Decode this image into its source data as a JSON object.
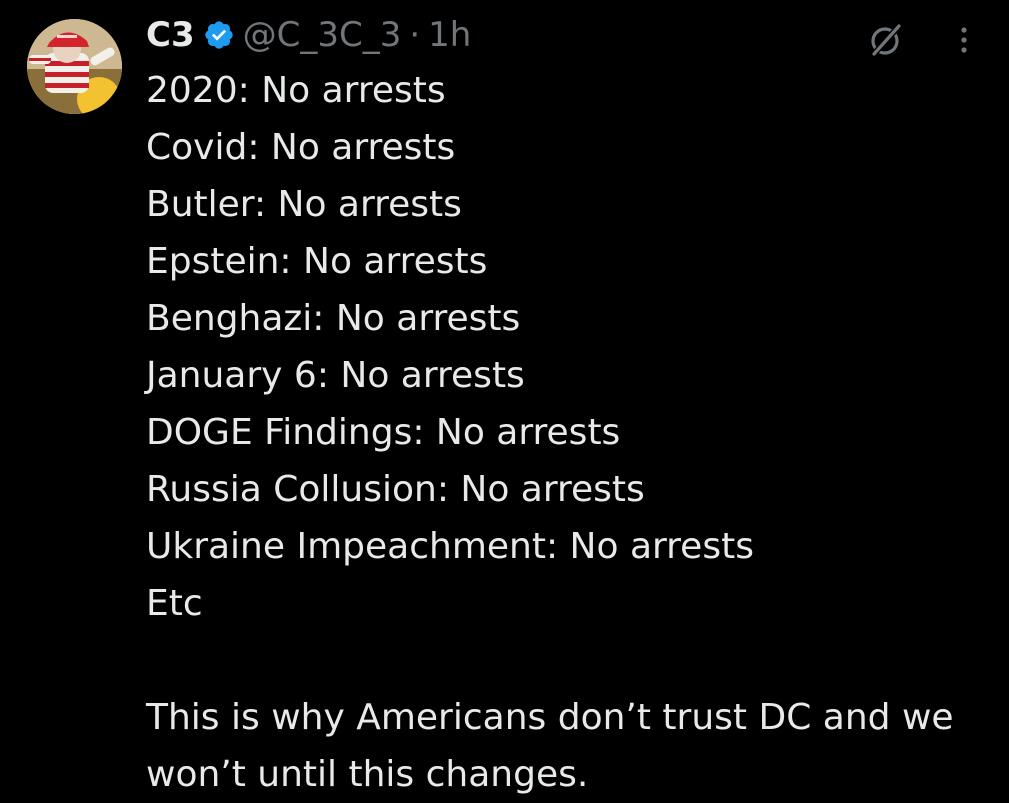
{
  "author": {
    "display_name": "C3",
    "handle": "@C_3C_3",
    "separator": "·",
    "time": "1h",
    "verified": true
  },
  "colors": {
    "background": "#000000",
    "text": "#e7e9ea",
    "secondary": "#71767b",
    "verified_badge": "#1d9bf0"
  },
  "icons": {
    "verified": "verified-badge-icon",
    "grok": "grok-icon",
    "more": "more-dots-icon"
  },
  "body": {
    "lines": [
      "2020: No arrests",
      "Covid: No arrests",
      "Butler: No arrests",
      "Epstein: No arrests",
      "Benghazi: No arrests",
      "January 6: No arrests",
      "DOGE Findings: No arrests",
      "Russia Collusion: No arrests",
      "Ukraine Impeachment: No arrests",
      "Etc"
    ],
    "closing": "This is why Americans don’t trust DC and we won’t until this changes."
  }
}
